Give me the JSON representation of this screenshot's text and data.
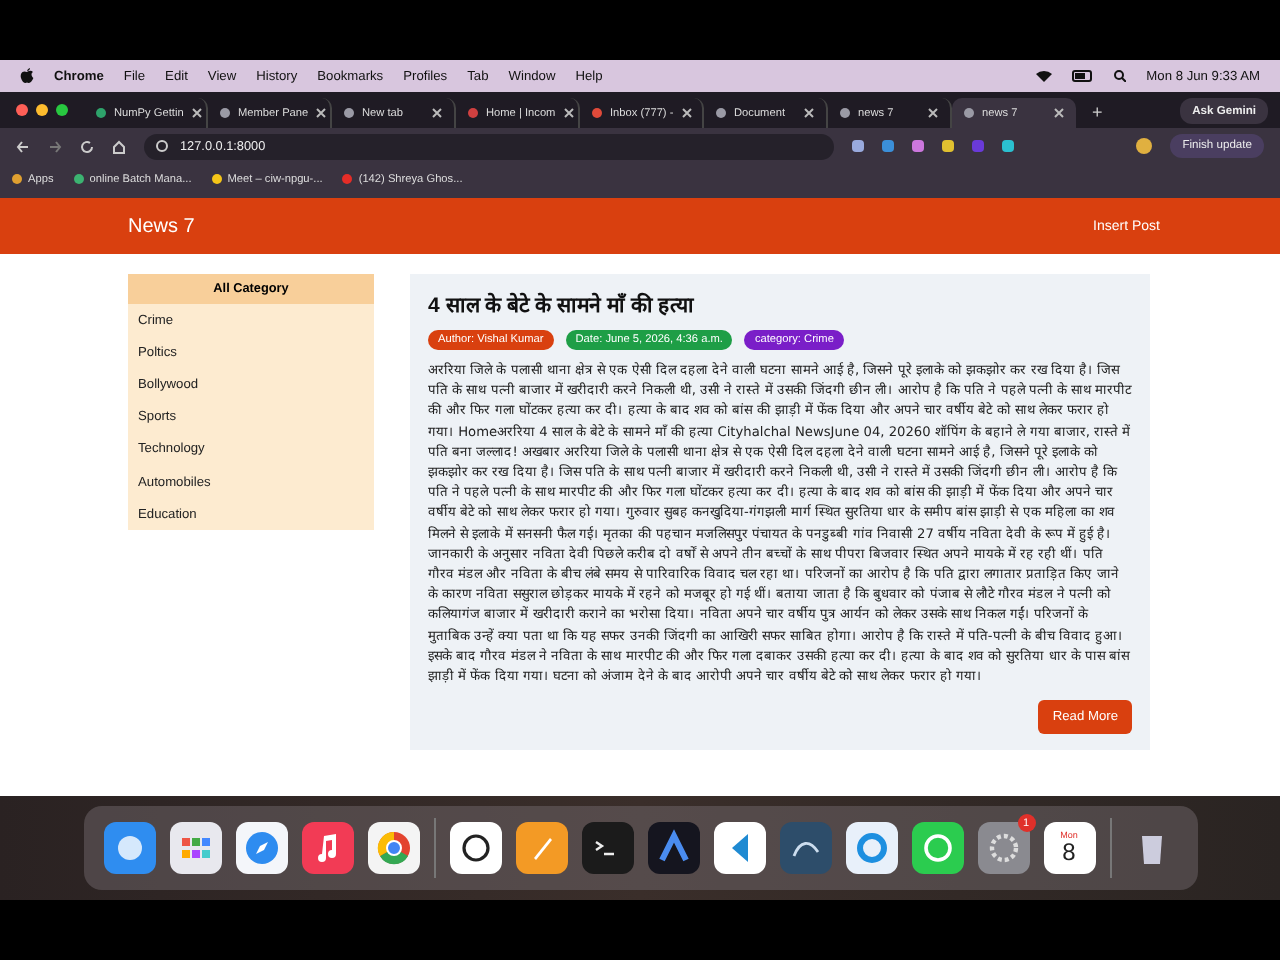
{
  "menubar": {
    "app": "Chrome",
    "menus": [
      "File",
      "Edit",
      "View",
      "History",
      "Bookmarks",
      "Profiles",
      "Tab",
      "Window",
      "Help"
    ],
    "clock": "Mon 8 Jun  9:33 AM"
  },
  "browser": {
    "tabs": [
      {
        "title": "NumPy Gettin",
        "selected": false,
        "color": "#2ea36b"
      },
      {
        "title": "Member Pane",
        "selected": false,
        "color": "#9a9aa5"
      },
      {
        "title": "New tab",
        "selected": false,
        "color": "#9a9aa5"
      },
      {
        "title": "Home | Incom",
        "selected": false,
        "color": "#d04040"
      },
      {
        "title": "Inbox (777) -",
        "selected": false,
        "color": "#e04a3a"
      },
      {
        "title": "Document",
        "selected": false,
        "color": "#9a9aa5"
      },
      {
        "title": "news 7",
        "selected": false,
        "color": "#9a9aa5"
      },
      {
        "title": "news 7",
        "selected": true,
        "color": "#9a9aa5"
      }
    ],
    "new_tab": "+",
    "gemini": "Ask Gemini",
    "address": "127.0.0.1:8000",
    "update": "Finish update",
    "bookmarks": [
      {
        "label": "Apps",
        "color": "#e0a030"
      },
      {
        "label": "online Batch Mana...",
        "color": "#3cb371"
      },
      {
        "label": "Meet – ciw-npgu-...",
        "color": "#f5c518"
      },
      {
        "label": "(142) Shreya Ghos...",
        "color": "#e52d27"
      }
    ]
  },
  "page": {
    "brand": "News 7",
    "nav": "Insert Post",
    "sidebar": {
      "heading": "All Category",
      "items": [
        "Crime",
        "Poltics",
        "Bollywood",
        "Sports",
        "Technology",
        "Automobiles",
        "Education"
      ]
    },
    "article": {
      "title": "4 साल के बेटे के सामने माँ की हत्या",
      "badges": [
        {
          "label": "Author: Vishal Kumar",
          "color": "#d9400f"
        },
        {
          "label": "Date: June 5, 2026, 4:36 a.m.",
          "color": "#1e9e46"
        },
        {
          "label": "category: Crime",
          "color": "#7a1ec8"
        }
      ],
      "body": "अररिया जिले के पलासी थाना क्षेत्र से एक ऐसी दिल दहला देने वाली घटना सामने आई है, जिसने पूरे इलाके को झकझोर कर रख दिया है। जिस पति के साथ पत्नी बाजार में खरीदारी करने निकली थी, उसी ने रास्ते में उसकी जिंदगी छीन ली। आरोप है कि पति ने पहले पत्नी के साथ मारपीट की और फिर गला घोंटकर हत्या कर दी। हत्या के बाद शव को बांस की झाड़ी में फेंक दिया और अपने चार वर्षीय बेटे को साथ लेकर फरार हो गया। Homeअररिया 4 साल के बेटे के सामने माँ की हत्या Cityhalchal NewsJune 04, 20260 शॉपिंग के बहाने ले गया बाजार, रास्ते में पति बना जल्लाद! अखबार अररिया जिले के पलासी थाना क्षेत्र से एक ऐसी दिल दहला देने वाली घटना सामने आई है, जिसने पूरे इलाके को झकझोर कर रख दिया है। जिस पति के साथ पत्नी बाजार में खरीदारी करने निकली थी, उसी ने रास्ते में उसकी जिंदगी छीन ली। आरोप है कि पति ने पहले पत्नी के साथ मारपीट की और फिर गला घोंटकर हत्या कर दी। हत्या के बाद शव को बांस की झाड़ी में फेंक दिया और अपने चार वर्षीय बेटे को साथ लेकर फरार हो गया। गुरुवार सुबह कनखुदिया-गंगझली मार्ग स्थित सुरतिया धार के समीप बांस झाड़ी से एक महिला का शव मिलने से इलाके में सनसनी फैल गई। मृतका की पहचान मजलिसपुर पंचायत के पनडुब्बी गांव निवासी 27 वर्षीय नविता देवी के रूप में हुई है। जानकारी के अनुसार नविता देवी पिछले करीब दो वर्षों से अपने तीन बच्चों के साथ पीपरा बिजवार स्थित अपने मायके में रह रही थीं। पति गौरव मंडल और नविता के बीच लंबे समय से पारिवारिक विवाद चल रहा था। परिजनों का आरोप है कि पति द्वारा लगातार प्रताड़ित किए जाने के कारण नविता ससुराल छोड़कर मायके में रहने को मजबूर हो गई थीं। बताया जाता है कि बुधवार को पंजाब से लौटे गौरव मंडल ने पत्नी को कलियागंज बाजार में खरीदारी कराने का भरोसा दिया। नविता अपने चार वर्षीय पुत्र आर्यन को लेकर उसके साथ निकल गईं। परिजनों के मुताबिक उन्हें क्या पता था कि यह सफर उनकी जिंदगी का आखिरी सफर साबित होगा। आरोप है कि रास्ते में पति-पत्नी के बीच विवाद हुआ। इसके बाद गौरव मंडल ने नविता के साथ मारपीट की और फिर गला दबाकर उसकी हत्या कर दी। हत्या के बाद शव को सुरतिया धार के पास बांस झाड़ी में फेंक दिया गया। घटना को अंजाम देने के बाद आरोपी अपने चार वर्षीय बेटे को साथ लेकर फरार हो गया।",
      "button": "Read More"
    }
  },
  "dock": {
    "apps": [
      {
        "kind": "finder"
      },
      {
        "kind": "launchpad"
      },
      {
        "kind": "safari"
      },
      {
        "kind": "music"
      },
      {
        "kind": "chrome"
      },
      {
        "kind": "separator"
      },
      {
        "kind": "chatgpt"
      },
      {
        "kind": "pages"
      },
      {
        "kind": "terminal"
      },
      {
        "kind": "arc"
      },
      {
        "kind": "vscode"
      },
      {
        "kind": "mysql"
      },
      {
        "kind": "quicktime"
      },
      {
        "kind": "whatsapp"
      },
      {
        "kind": "settings",
        "badge": "1"
      },
      {
        "kind": "calendar",
        "weekday": "Mon",
        "day": "8"
      },
      {
        "kind": "separator"
      },
      {
        "kind": "trash"
      }
    ]
  }
}
